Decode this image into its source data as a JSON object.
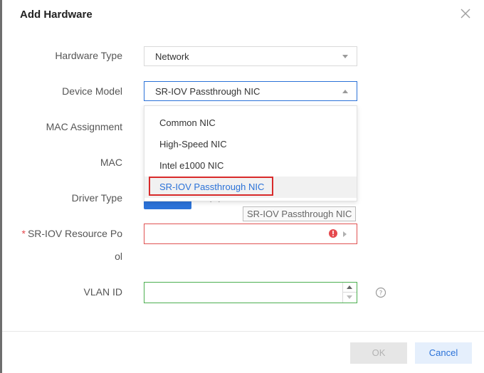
{
  "dialog": {
    "title": "Add Hardware"
  },
  "form": {
    "hardware_type_label": "Hardware Type",
    "hardware_type_value": "Network",
    "device_model_label": "Device Model",
    "device_model_value": "SR-IOV Passthrough NIC",
    "mac_assignment_label": "MAC Assignment",
    "mac_label": "MAC",
    "driver_type_label": "Driver Type",
    "sriov_pool_label_line1": "SR-IOV Resource Po",
    "sriov_pool_label_line2": "ol",
    "sriov_pool_required_mark": "*",
    "vlan_id_label": "VLAN ID",
    "vlan_id_value": ""
  },
  "dropdown": {
    "options": [
      {
        "label": "Common NIC"
      },
      {
        "label": "High-Speed NIC"
      },
      {
        "label": "Intel e1000 NIC"
      },
      {
        "label": "SR-IOV Passthrough NIC"
      }
    ],
    "selected_index": 3
  },
  "tooltip": {
    "text": "SR-IOV Passthrough NIC"
  },
  "footer": {
    "ok_label": "OK",
    "cancel_label": "Cancel"
  },
  "colors": {
    "accent": "#2b72d8",
    "error": "#e05252",
    "valid": "#4caf50",
    "highlight": "#d82a2a"
  },
  "icons": {
    "close": "close-icon",
    "caret": "chevron-down-icon",
    "error": "error-icon",
    "help": "help-icon"
  }
}
